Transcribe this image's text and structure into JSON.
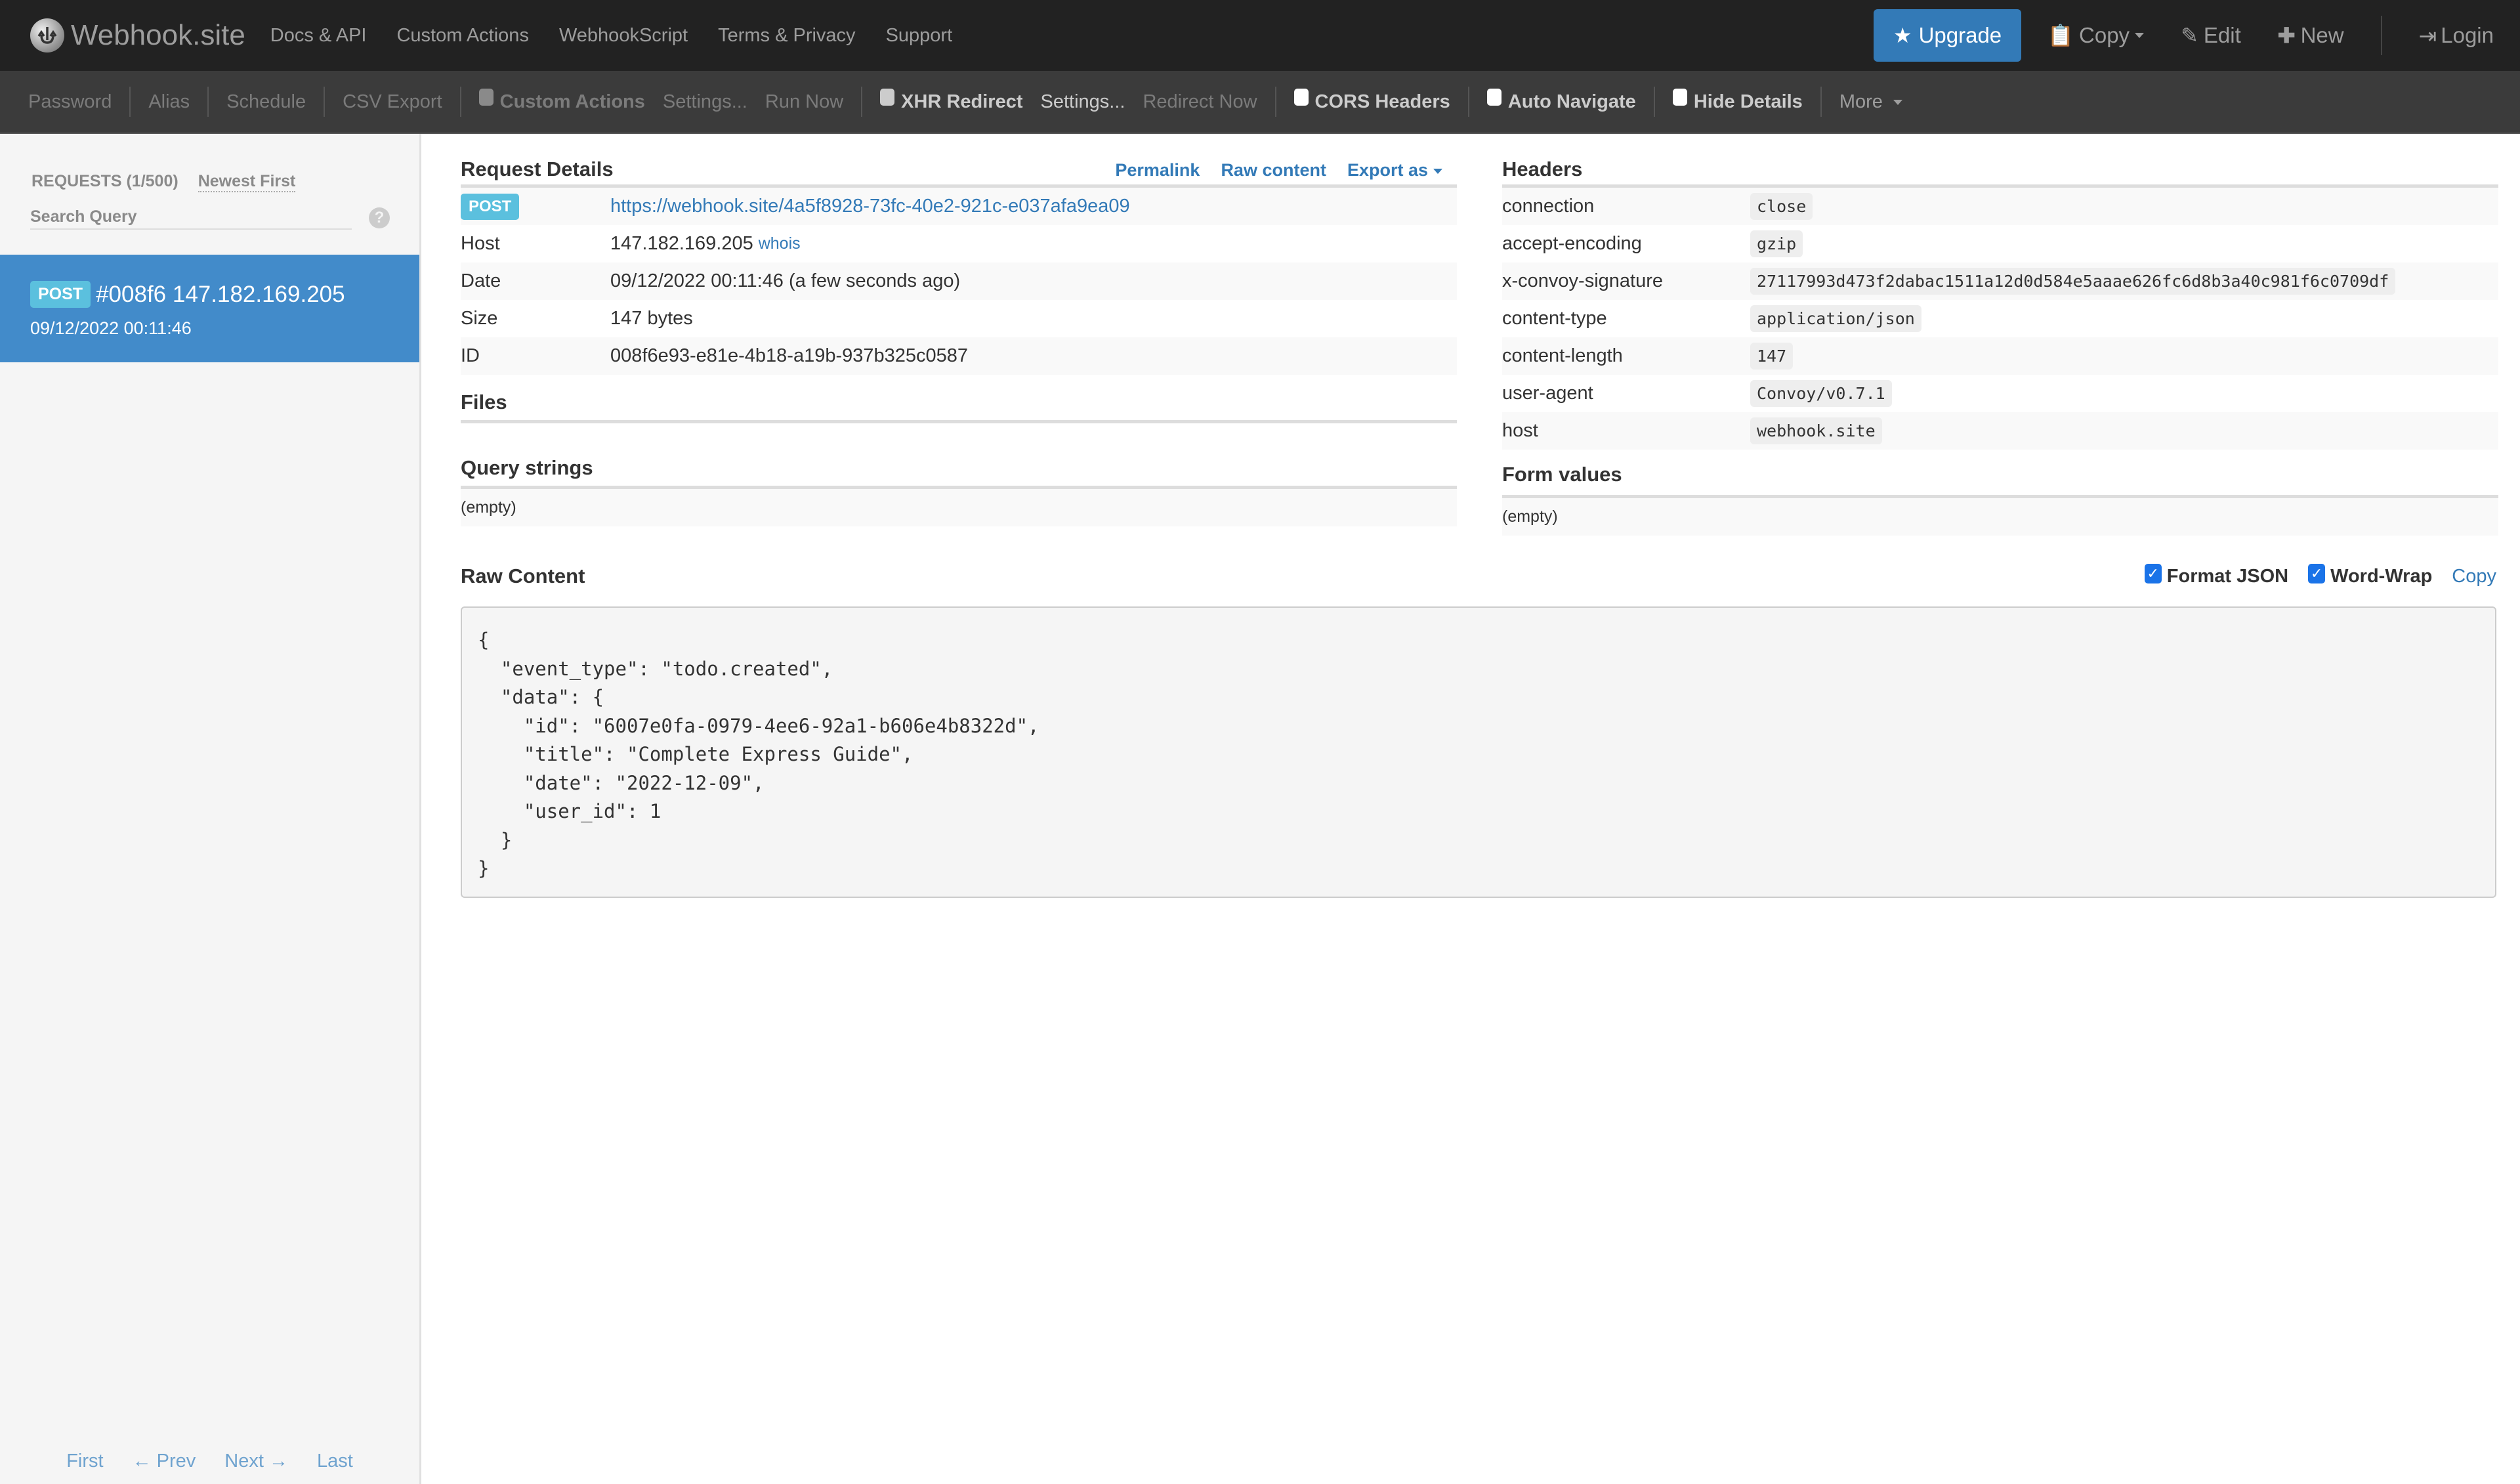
{
  "navbar": {
    "brand": "Webhook.site",
    "links": [
      "Docs & API",
      "Custom Actions",
      "WebhookScript",
      "Terms & Privacy",
      "Support"
    ],
    "upgrade": "Upgrade",
    "copy": "Copy",
    "edit": "Edit",
    "new": "New",
    "login": "Login"
  },
  "toolbar": {
    "password": "Password",
    "alias": "Alias",
    "schedule": "Schedule",
    "csv_export": "CSV Export",
    "custom_actions": "Custom Actions",
    "custom_actions_settings": "Settings...",
    "run_now": "Run Now",
    "xhr_redirect": "XHR Redirect",
    "xhr_settings": "Settings...",
    "redirect_now": "Redirect Now",
    "cors_headers": "CORS Headers",
    "auto_navigate": "Auto Navigate",
    "hide_details": "Hide Details",
    "more": "More"
  },
  "sidebar": {
    "requests_label": "REQUESTS (1/500)",
    "sort": "Newest First",
    "search_placeholder": "Search Query",
    "help": "?",
    "request": {
      "method": "POST",
      "title": "#008f6 147.182.169.205",
      "time": "09/12/2022 00:11:46"
    },
    "pager": {
      "first": "First",
      "prev": "← Prev",
      "next": "Next →",
      "last": "Last"
    }
  },
  "details": {
    "title": "Request Details",
    "permalink": "Permalink",
    "raw_content_link": "Raw content",
    "export_as": "Export as",
    "method": "POST",
    "url": "https://webhook.site/4a5f8928-73fc-40e2-921c-e037afa9ea09",
    "rows": [
      {
        "key": "Host",
        "value": "147.182.169.205",
        "extra": "whois"
      },
      {
        "key": "Date",
        "value": "09/12/2022 00:11:46 (a few seconds ago)"
      },
      {
        "key": "Size",
        "value": "147 bytes"
      },
      {
        "key": "ID",
        "value": "008f6e93-e81e-4b18-a19b-937b325c0587"
      }
    ]
  },
  "files": {
    "title": "Files"
  },
  "query_strings": {
    "title": "Query strings",
    "empty": "(empty)"
  },
  "headers": {
    "title": "Headers",
    "rows": [
      {
        "key": "connection",
        "value": "close"
      },
      {
        "key": "accept-encoding",
        "value": "gzip"
      },
      {
        "key": "x-convoy-signature",
        "value": "27117993d473f2dabac1511a12d0d584e5aaae626fc6d8b3a40c981f6c0709df"
      },
      {
        "key": "content-type",
        "value": "application/json"
      },
      {
        "key": "content-length",
        "value": "147"
      },
      {
        "key": "user-agent",
        "value": "Convoy/v0.7.1"
      },
      {
        "key": "host",
        "value": "webhook.site"
      }
    ]
  },
  "form_values": {
    "title": "Form values",
    "empty": "(empty)"
  },
  "raw": {
    "title": "Raw Content",
    "format_json": "Format JSON",
    "format_json_checked": true,
    "word_wrap": "Word-Wrap",
    "word_wrap_checked": true,
    "copy": "Copy",
    "body": "{\n  \"event_type\": \"todo.created\",\n  \"data\": {\n    \"id\": \"6007e0fa-0979-4ee6-92a1-b606e4b8322d\",\n    \"title\": \"Complete Express Guide\",\n    \"date\": \"2022-12-09\",\n    \"user_id\": 1\n  }\n}"
  }
}
